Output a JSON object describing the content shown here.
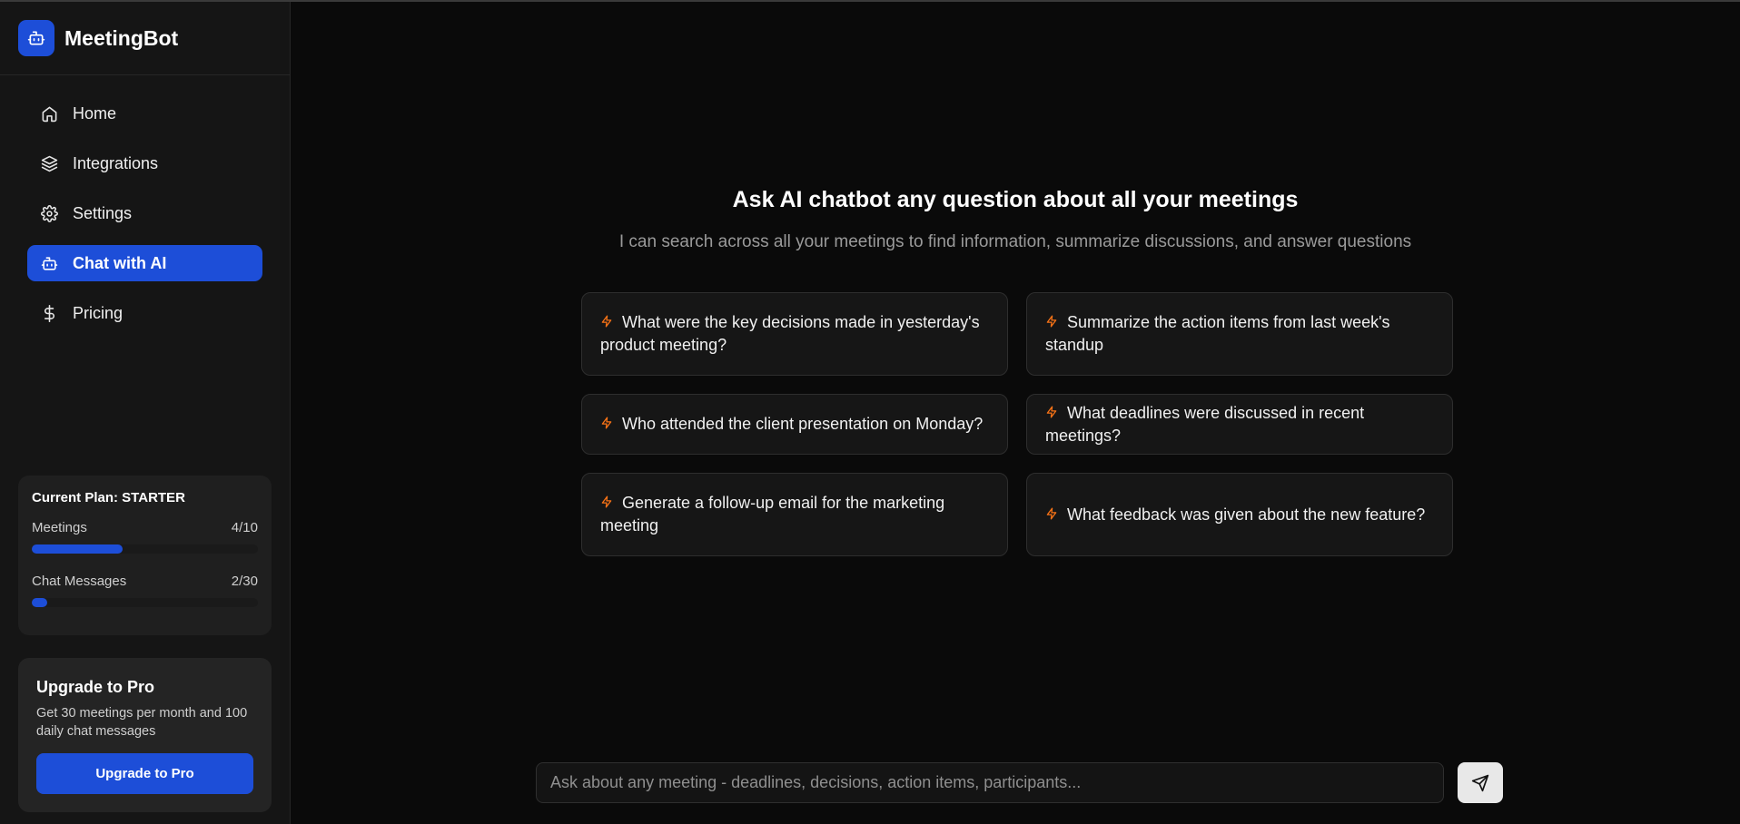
{
  "brand": {
    "name": "MeetingBot",
    "icon": "bot-icon",
    "color": "#1d4ed8"
  },
  "nav": {
    "items": [
      {
        "label": "Home",
        "icon": "home-icon",
        "active": false
      },
      {
        "label": "Integrations",
        "icon": "layers-icon",
        "active": false
      },
      {
        "label": "Settings",
        "icon": "gear-icon",
        "active": false
      },
      {
        "label": "Chat with AI",
        "icon": "bot-icon",
        "active": true
      },
      {
        "label": "Pricing",
        "icon": "dollar-icon",
        "active": false
      }
    ]
  },
  "plan": {
    "title": "Current Plan: STARTER",
    "meetings": {
      "label": "Meetings",
      "value": "4/10",
      "fraction": 0.4
    },
    "chat_messages": {
      "label": "Chat Messages",
      "value": "2/30",
      "fraction": 0.0667
    }
  },
  "upgrade": {
    "title": "Upgrade to Pro",
    "description": "Get 30 meetings per month and 100 daily chat messages",
    "button_label": "Upgrade to Pro"
  },
  "main": {
    "title": "Ask AI chatbot any question about all your meetings",
    "subtitle": "I can search across all your meetings to find information, summarize discussions, and answer questions",
    "suggestions": [
      "What were the key decisions made in yesterday's product meeting?",
      "Summarize the action items from last week's standup",
      "Who attended the client presentation on Monday?",
      "What deadlines were discussed in recent meetings?",
      "Generate a follow-up email for the marketing meeting",
      "What feedback was given about the new feature?"
    ],
    "suggestion_icon": "lightning-icon",
    "suggestion_icon_color": "#f97316"
  },
  "composer": {
    "placeholder": "Ask about any meeting - deadlines, decisions, action items, participants...",
    "value": "",
    "send_icon": "send-icon"
  },
  "colors": {
    "accent": "#1d4ed8",
    "background": "#0a0a0a",
    "sidebar": "#151515"
  }
}
